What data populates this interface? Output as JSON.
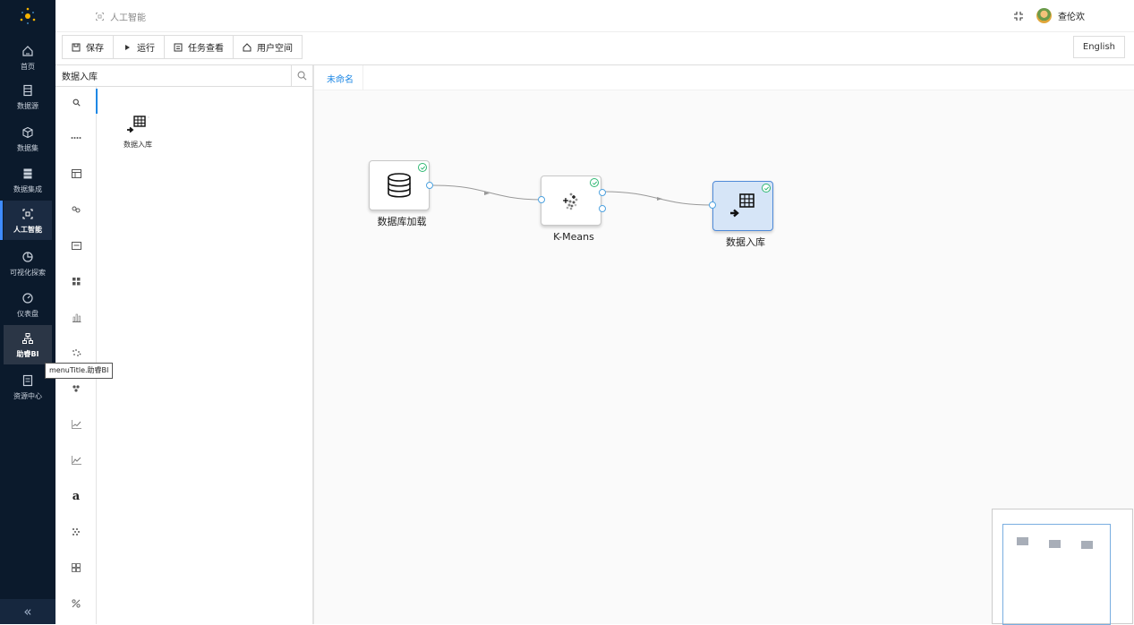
{
  "header": {
    "breadcrumb": "人工智能",
    "username": "查伦欢"
  },
  "nav": {
    "items": [
      {
        "label": "首页",
        "icon": "home-icon"
      },
      {
        "label": "数据源",
        "icon": "database-icon"
      },
      {
        "label": "数据集",
        "icon": "cube-icon"
      },
      {
        "label": "数据集成",
        "icon": "stack-icon"
      },
      {
        "label": "人工智能",
        "icon": "ai-icon"
      },
      {
        "label": "可视化探索",
        "icon": "pie-chart-icon"
      },
      {
        "label": "仪表盘",
        "icon": "gauge-icon"
      },
      {
        "label": "助睿BI",
        "icon": "org-chart-icon"
      },
      {
        "label": "资源中心",
        "icon": "book-icon"
      }
    ],
    "active": "人工智能",
    "hovered": "助睿BI",
    "tooltip": "menuTitle.助睿BI",
    "collapse": "«"
  },
  "toolbar": {
    "save": "保存",
    "run": "运行",
    "tasks": "任务查看",
    "user_space": "用户空间",
    "language": "English"
  },
  "panel": {
    "search_value": "数据入库",
    "result_label": "数据入库",
    "categories": [
      "search",
      "dots",
      "table",
      "link",
      "card",
      "grid",
      "bars",
      "scatter",
      "cluster",
      "line",
      "area",
      "text",
      "pattern",
      "cells",
      "percent"
    ]
  },
  "canvas": {
    "tab": "未命名",
    "nodes": [
      {
        "label": "数据库加载",
        "icon": "database-icon",
        "status": "success"
      },
      {
        "label": "K-Means",
        "icon": "kmeans-icon",
        "status": "success"
      },
      {
        "label": "数据入库",
        "icon": "table-import-icon",
        "status": "success",
        "selected": true
      }
    ],
    "colors": {
      "nav_bg": "#0b1a2c",
      "accent": "#1e88e5",
      "success": "#2eb872",
      "selected_node": "#d6e5f7"
    }
  }
}
